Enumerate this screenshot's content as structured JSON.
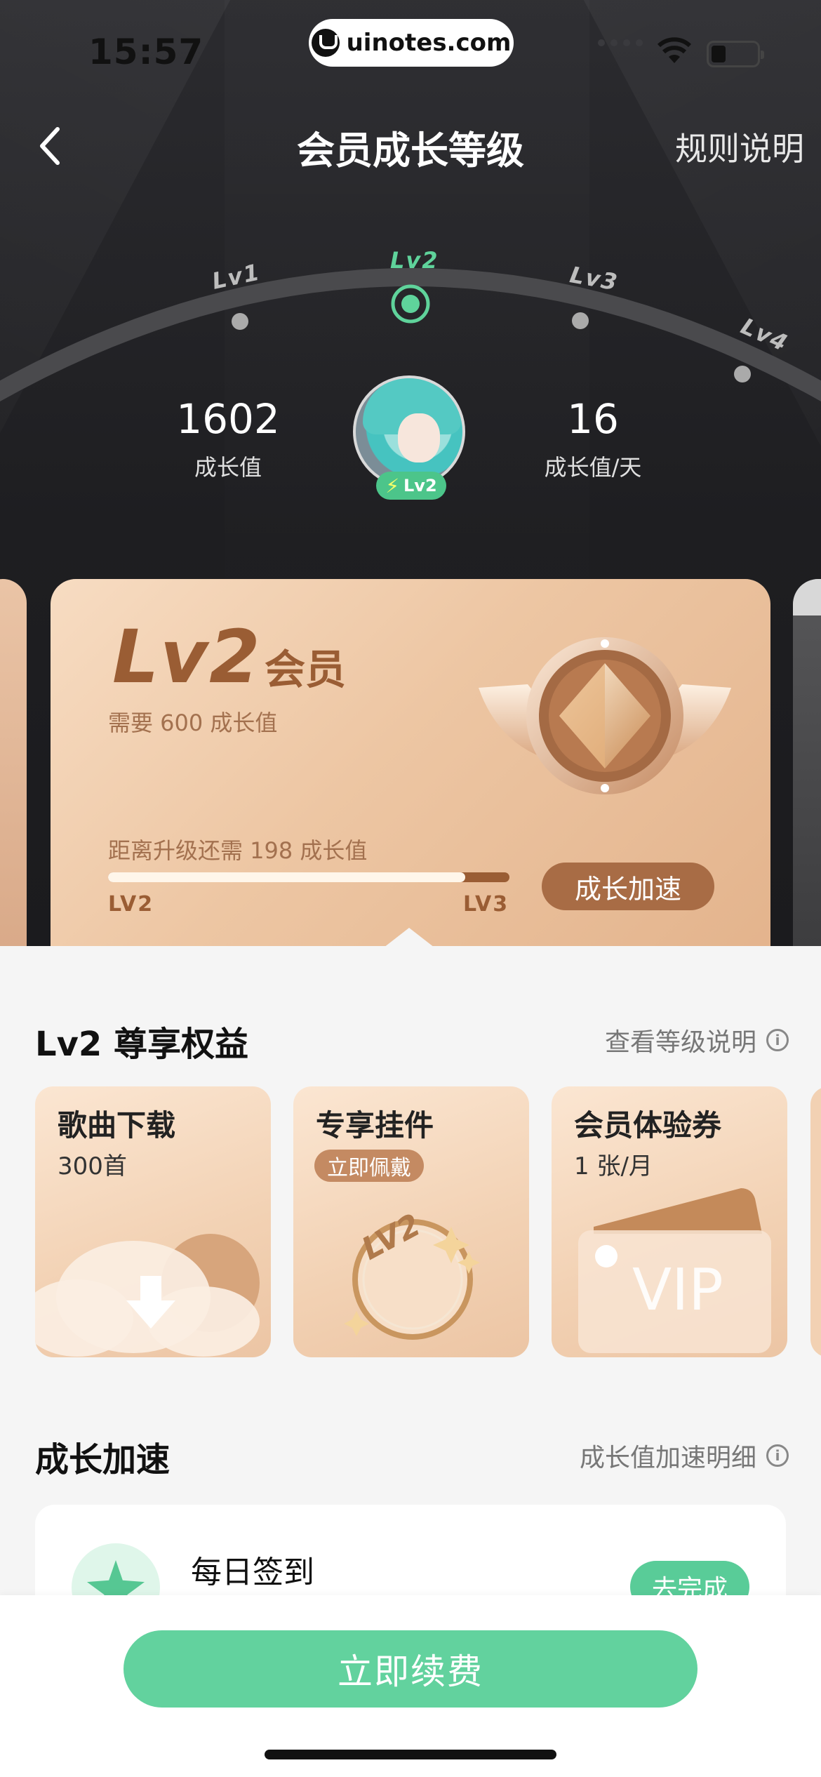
{
  "status_bar": {
    "time": "15:57",
    "watermark": "uinotes.com"
  },
  "nav": {
    "title": "会员成长等级",
    "rules_link": "规则说明"
  },
  "level_track": {
    "levels": [
      "Lv1",
      "Lv2",
      "Lv3",
      "Lv4"
    ],
    "current": "Lv2"
  },
  "stats": {
    "growth_value": "1602",
    "growth_label": "成长值",
    "daily_value": "16",
    "daily_label": "成长值/天"
  },
  "avatar_badge": "Lv2",
  "level_card": {
    "level": "Lv2",
    "member": "会员",
    "requirement": "需要 600 成长值",
    "distance": "距离升级还需 198 成长值",
    "progress": 0.89,
    "from": "LV2",
    "to": "LV3",
    "boost_button": "成长加速"
  },
  "benefits": {
    "title": "Lv2 尊享权益",
    "link": "查看等级说明",
    "items": [
      {
        "title": "歌曲下载",
        "sub": "300首"
      },
      {
        "title": "专享挂件",
        "pill": "立即佩戴"
      },
      {
        "title": "会员体验券",
        "sub": "1 张/月"
      }
    ],
    "vip_text": "VIP",
    "pendant_text": "LV2"
  },
  "boost_section": {
    "title": "成长加速",
    "link": "成长值加速明细",
    "task": {
      "title": "每日签到",
      "button": "去完成"
    }
  },
  "renew_button": "立即续费",
  "colors": {
    "accent_green": "#62d29e",
    "gold_brown": "#9a5d34",
    "hero_dark": "#1e1e21"
  }
}
